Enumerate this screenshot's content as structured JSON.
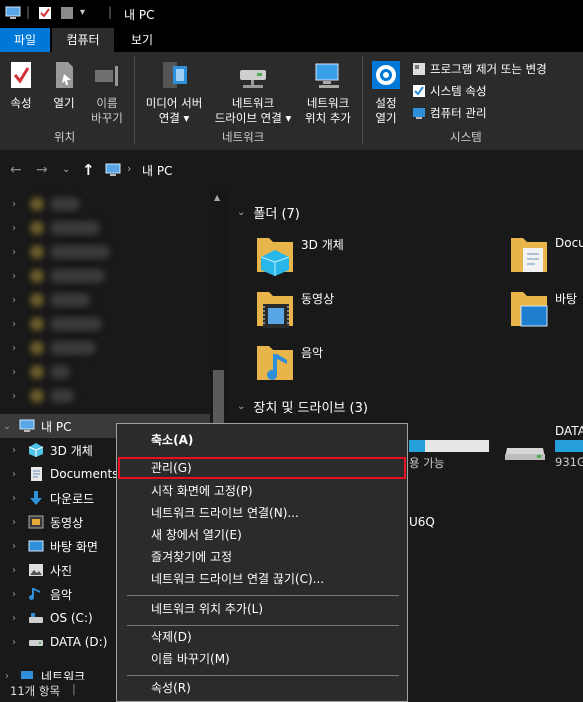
{
  "titlebar": {
    "title": "내 PC"
  },
  "ribbon_tabs": [
    {
      "label": "파일"
    },
    {
      "label": "컴퓨터"
    },
    {
      "label": "보기"
    }
  ],
  "ribbon": {
    "location_group": {
      "label": "위치",
      "properties": "속성",
      "open": "열기",
      "rename_l1": "이름",
      "rename_l2": "바꾸기"
    },
    "network_group": {
      "label": "네트워크",
      "media_l1": "미디어 서버",
      "media_l2": "연결 ▾",
      "map_l1": "네트워크",
      "map_l2": "드라이브 연결 ▾",
      "addloc_l1": "네트워크",
      "addloc_l2": "위치 추가"
    },
    "system_group": {
      "label": "시스템",
      "settings_l1": "설정",
      "settings_l2": "열기",
      "uninstall": "프로그램 제거 또는 변경",
      "sysprops": "시스템 속성",
      "manage": "컴퓨터 관리"
    }
  },
  "address": {
    "path": "내 PC"
  },
  "nav": {
    "this_pc": "내 PC",
    "items": [
      {
        "label": "3D 개체",
        "icon": "cube-icon"
      },
      {
        "label": "Documents",
        "icon": "document-icon"
      },
      {
        "label": "다운로드",
        "icon": "download-icon"
      },
      {
        "label": "동영상",
        "icon": "video-icon"
      },
      {
        "label": "바탕 화면",
        "icon": "desktop-icon"
      },
      {
        "label": "사진",
        "icon": "picture-icon"
      },
      {
        "label": "음악",
        "icon": "music-icon"
      },
      {
        "label": "OS (C:)",
        "icon": "drive-icon"
      },
      {
        "label": "DATA (D:)",
        "icon": "drive-icon"
      }
    ],
    "network": "네트워크"
  },
  "content": {
    "folders_header": "폴더 (7)",
    "folders": [
      {
        "label": "3D 개체"
      },
      {
        "label": "Docu"
      },
      {
        "label": "동영상"
      },
      {
        "label": "바탕"
      },
      {
        "label": "음악"
      }
    ],
    "devices_header": "장치 및 드라이브 (3)",
    "drive_c_free": "용 가능",
    "drive_d_name": "DATA",
    "drive_d_size": "931G",
    "partial_text": "U6Q",
    "drive_c_usage_fraction": 0.2
  },
  "status": {
    "count": "11개 항목"
  },
  "context_menu": {
    "items": [
      "축소(A)",
      "관리(G)",
      "시작 화면에 고정(P)",
      "네트워크 드라이브 연결(N)...",
      "새 창에서 열기(E)",
      "즐겨찾기에 고정",
      "네트워크 드라이브 연결 끊기(C)...",
      "네트워크 위치 추가(L)",
      "삭제(D)",
      "이름 바꾸기(M)",
      "속성(R)"
    ],
    "highlighted": "관리(G)",
    "highlight_color": "#e81123"
  },
  "colors": {
    "accent": "#0078d7",
    "background": "#191919",
    "ribbon": "#2b2b2b"
  }
}
